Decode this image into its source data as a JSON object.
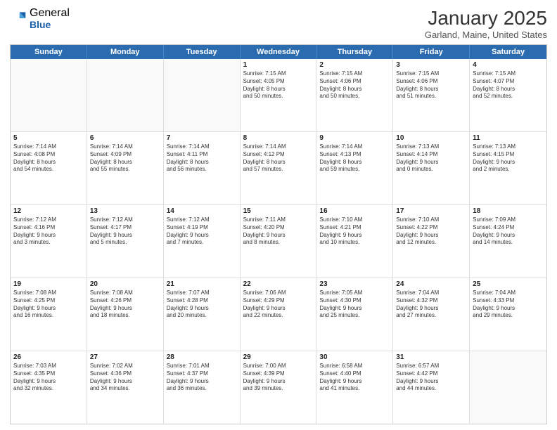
{
  "header": {
    "logo_general": "General",
    "logo_blue": "Blue",
    "month_title": "January 2025",
    "location": "Garland, Maine, United States"
  },
  "days_of_week": [
    "Sunday",
    "Monday",
    "Tuesday",
    "Wednesday",
    "Thursday",
    "Friday",
    "Saturday"
  ],
  "weeks": [
    [
      {
        "day": "",
        "empty": true,
        "lines": []
      },
      {
        "day": "",
        "empty": true,
        "lines": []
      },
      {
        "day": "",
        "empty": true,
        "lines": []
      },
      {
        "day": "1",
        "empty": false,
        "lines": [
          "Sunrise: 7:15 AM",
          "Sunset: 4:05 PM",
          "Daylight: 8 hours",
          "and 50 minutes."
        ]
      },
      {
        "day": "2",
        "empty": false,
        "lines": [
          "Sunrise: 7:15 AM",
          "Sunset: 4:06 PM",
          "Daylight: 8 hours",
          "and 50 minutes."
        ]
      },
      {
        "day": "3",
        "empty": false,
        "lines": [
          "Sunrise: 7:15 AM",
          "Sunset: 4:06 PM",
          "Daylight: 8 hours",
          "and 51 minutes."
        ]
      },
      {
        "day": "4",
        "empty": false,
        "lines": [
          "Sunrise: 7:15 AM",
          "Sunset: 4:07 PM",
          "Daylight: 8 hours",
          "and 52 minutes."
        ]
      }
    ],
    [
      {
        "day": "5",
        "empty": false,
        "lines": [
          "Sunrise: 7:14 AM",
          "Sunset: 4:08 PM",
          "Daylight: 8 hours",
          "and 54 minutes."
        ]
      },
      {
        "day": "6",
        "empty": false,
        "lines": [
          "Sunrise: 7:14 AM",
          "Sunset: 4:09 PM",
          "Daylight: 8 hours",
          "and 55 minutes."
        ]
      },
      {
        "day": "7",
        "empty": false,
        "lines": [
          "Sunrise: 7:14 AM",
          "Sunset: 4:11 PM",
          "Daylight: 8 hours",
          "and 56 minutes."
        ]
      },
      {
        "day": "8",
        "empty": false,
        "lines": [
          "Sunrise: 7:14 AM",
          "Sunset: 4:12 PM",
          "Daylight: 8 hours",
          "and 57 minutes."
        ]
      },
      {
        "day": "9",
        "empty": false,
        "lines": [
          "Sunrise: 7:14 AM",
          "Sunset: 4:13 PM",
          "Daylight: 8 hours",
          "and 59 minutes."
        ]
      },
      {
        "day": "10",
        "empty": false,
        "lines": [
          "Sunrise: 7:13 AM",
          "Sunset: 4:14 PM",
          "Daylight: 9 hours",
          "and 0 minutes."
        ]
      },
      {
        "day": "11",
        "empty": false,
        "lines": [
          "Sunrise: 7:13 AM",
          "Sunset: 4:15 PM",
          "Daylight: 9 hours",
          "and 2 minutes."
        ]
      }
    ],
    [
      {
        "day": "12",
        "empty": false,
        "lines": [
          "Sunrise: 7:12 AM",
          "Sunset: 4:16 PM",
          "Daylight: 9 hours",
          "and 3 minutes."
        ]
      },
      {
        "day": "13",
        "empty": false,
        "lines": [
          "Sunrise: 7:12 AM",
          "Sunset: 4:17 PM",
          "Daylight: 9 hours",
          "and 5 minutes."
        ]
      },
      {
        "day": "14",
        "empty": false,
        "lines": [
          "Sunrise: 7:12 AM",
          "Sunset: 4:19 PM",
          "Daylight: 9 hours",
          "and 7 minutes."
        ]
      },
      {
        "day": "15",
        "empty": false,
        "lines": [
          "Sunrise: 7:11 AM",
          "Sunset: 4:20 PM",
          "Daylight: 9 hours",
          "and 8 minutes."
        ]
      },
      {
        "day": "16",
        "empty": false,
        "lines": [
          "Sunrise: 7:10 AM",
          "Sunset: 4:21 PM",
          "Daylight: 9 hours",
          "and 10 minutes."
        ]
      },
      {
        "day": "17",
        "empty": false,
        "lines": [
          "Sunrise: 7:10 AM",
          "Sunset: 4:22 PM",
          "Daylight: 9 hours",
          "and 12 minutes."
        ]
      },
      {
        "day": "18",
        "empty": false,
        "lines": [
          "Sunrise: 7:09 AM",
          "Sunset: 4:24 PM",
          "Daylight: 9 hours",
          "and 14 minutes."
        ]
      }
    ],
    [
      {
        "day": "19",
        "empty": false,
        "lines": [
          "Sunrise: 7:08 AM",
          "Sunset: 4:25 PM",
          "Daylight: 9 hours",
          "and 16 minutes."
        ]
      },
      {
        "day": "20",
        "empty": false,
        "lines": [
          "Sunrise: 7:08 AM",
          "Sunset: 4:26 PM",
          "Daylight: 9 hours",
          "and 18 minutes."
        ]
      },
      {
        "day": "21",
        "empty": false,
        "lines": [
          "Sunrise: 7:07 AM",
          "Sunset: 4:28 PM",
          "Daylight: 9 hours",
          "and 20 minutes."
        ]
      },
      {
        "day": "22",
        "empty": false,
        "lines": [
          "Sunrise: 7:06 AM",
          "Sunset: 4:29 PM",
          "Daylight: 9 hours",
          "and 22 minutes."
        ]
      },
      {
        "day": "23",
        "empty": false,
        "lines": [
          "Sunrise: 7:05 AM",
          "Sunset: 4:30 PM",
          "Daylight: 9 hours",
          "and 25 minutes."
        ]
      },
      {
        "day": "24",
        "empty": false,
        "lines": [
          "Sunrise: 7:04 AM",
          "Sunset: 4:32 PM",
          "Daylight: 9 hours",
          "and 27 minutes."
        ]
      },
      {
        "day": "25",
        "empty": false,
        "lines": [
          "Sunrise: 7:04 AM",
          "Sunset: 4:33 PM",
          "Daylight: 9 hours",
          "and 29 minutes."
        ]
      }
    ],
    [
      {
        "day": "26",
        "empty": false,
        "lines": [
          "Sunrise: 7:03 AM",
          "Sunset: 4:35 PM",
          "Daylight: 9 hours",
          "and 32 minutes."
        ]
      },
      {
        "day": "27",
        "empty": false,
        "lines": [
          "Sunrise: 7:02 AM",
          "Sunset: 4:36 PM",
          "Daylight: 9 hours",
          "and 34 minutes."
        ]
      },
      {
        "day": "28",
        "empty": false,
        "lines": [
          "Sunrise: 7:01 AM",
          "Sunset: 4:37 PM",
          "Daylight: 9 hours",
          "and 36 minutes."
        ]
      },
      {
        "day": "29",
        "empty": false,
        "lines": [
          "Sunrise: 7:00 AM",
          "Sunset: 4:39 PM",
          "Daylight: 9 hours",
          "and 39 minutes."
        ]
      },
      {
        "day": "30",
        "empty": false,
        "lines": [
          "Sunrise: 6:58 AM",
          "Sunset: 4:40 PM",
          "Daylight: 9 hours",
          "and 41 minutes."
        ]
      },
      {
        "day": "31",
        "empty": false,
        "lines": [
          "Sunrise: 6:57 AM",
          "Sunset: 4:42 PM",
          "Daylight: 9 hours",
          "and 44 minutes."
        ]
      },
      {
        "day": "",
        "empty": true,
        "lines": []
      }
    ]
  ]
}
